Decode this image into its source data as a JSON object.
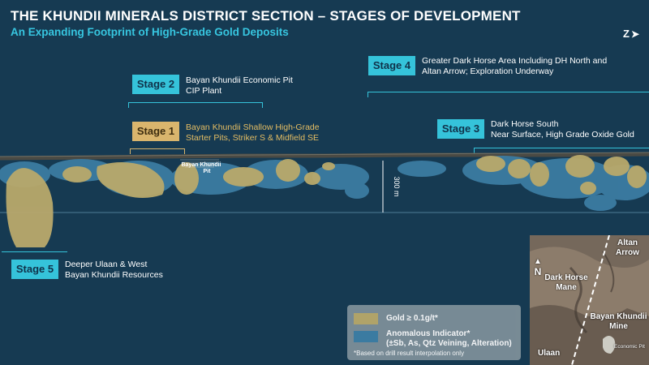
{
  "header": {
    "title": "THE KHUNDII MINERALS DISTRICT SECTION – STAGES OF DEVELOPMENT",
    "subtitle": "An Expanding Footprint of High-Grade Gold Deposits",
    "compass": "Z"
  },
  "stages": [
    {
      "label": "Stage 1",
      "line1": "Bayan Khundii  Shallow High-Grade",
      "line2": "Starter Pits, Striker S & Midfield SE",
      "color": "#d9b56d"
    },
    {
      "label": "Stage 2",
      "line1": "Bayan Khundii Economic Pit",
      "line2": "CIP Plant",
      "color": "#35c3da"
    },
    {
      "label": "Stage 3",
      "line1": "Dark Horse South",
      "line2": "Near Surface, High Grade Oxide Gold",
      "color": "#35c3da"
    },
    {
      "label": "Stage 4",
      "line1": "Greater Dark Horse Area Including DH North and",
      "line2": "Altan Arrow; Exploration Underway",
      "color": "#35c3da"
    },
    {
      "label": "Stage 5",
      "line1": "Deeper Ulaan & West",
      "line2": "Bayan Khundii Resources",
      "color": "#35c3da"
    }
  ],
  "section": {
    "pit_label_line1": "Bayan Khundii",
    "pit_label_line2": "Pit",
    "depth_label": "300 m"
  },
  "legend": {
    "gold_label": "Gold ≥ 0.1g/t*",
    "anomalous_label": "Anomalous Indicator*",
    "anomalous_detail": "(±Sb, As, Qtz Veining, Alteration)",
    "note": "*Based on drill result interpolation only",
    "gold_color": "#b9a96b",
    "anomalous_color": "#3d7fa6"
  },
  "map": {
    "north": "N",
    "altan_arrow": "Altan Arrow",
    "dark_horse_mane": "Dark Horse Mane",
    "bayan_khundii_mine": "Bayan Khundii Mine",
    "ulaan": "Ulaan",
    "economic_pit": "Economic Pit"
  }
}
